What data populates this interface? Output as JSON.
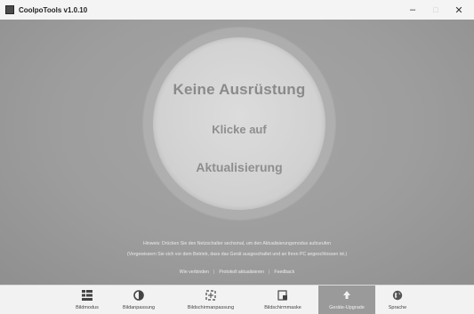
{
  "window": {
    "title": "CoolpoTools v1.0.10",
    "minimize": "–",
    "maximize": "□",
    "close": "✕"
  },
  "main": {
    "circle_line1": "Keine Ausrüstung",
    "circle_line2": "Klicke auf",
    "circle_line3": "Aktualisierung",
    "hint_line1": "Hinweis: Drücken Sie den Netzschalter sechsmal, um den Aktualisierungsmodus aufzurufen",
    "hint_line2": "(Vergewissern Sie sich vor dem Betrieb, dass das Gerät ausgeschaltet und an Ihren PC angeschlossen ist.)",
    "links": {
      "connect": "Wie verbinden",
      "update_protocol": "Protokoll aktualisieren",
      "feedback": "Feedback",
      "separator": "|"
    }
  },
  "nav": {
    "items": [
      {
        "label": "Bildmodus",
        "icon": "grid-icon",
        "active": false
      },
      {
        "label": "Bildanpassung",
        "icon": "adjust-icon",
        "active": false
      },
      {
        "label": "Bildschirmanpassung",
        "icon": "screen-adjust-icon",
        "active": false
      },
      {
        "label": "Bildschirmmaske",
        "icon": "screen-mask-icon",
        "active": false
      },
      {
        "label": "Geräte-Upgrade",
        "icon": "upload-icon",
        "active": true
      },
      {
        "label": "Sprache",
        "icon": "globe-icon",
        "active": false
      }
    ]
  },
  "colors": {
    "main_bg": "#9d9d9d",
    "circle": "#d6d6d6",
    "circle_text": "#8a8a8a",
    "active_nav": "#9a9a9a"
  }
}
